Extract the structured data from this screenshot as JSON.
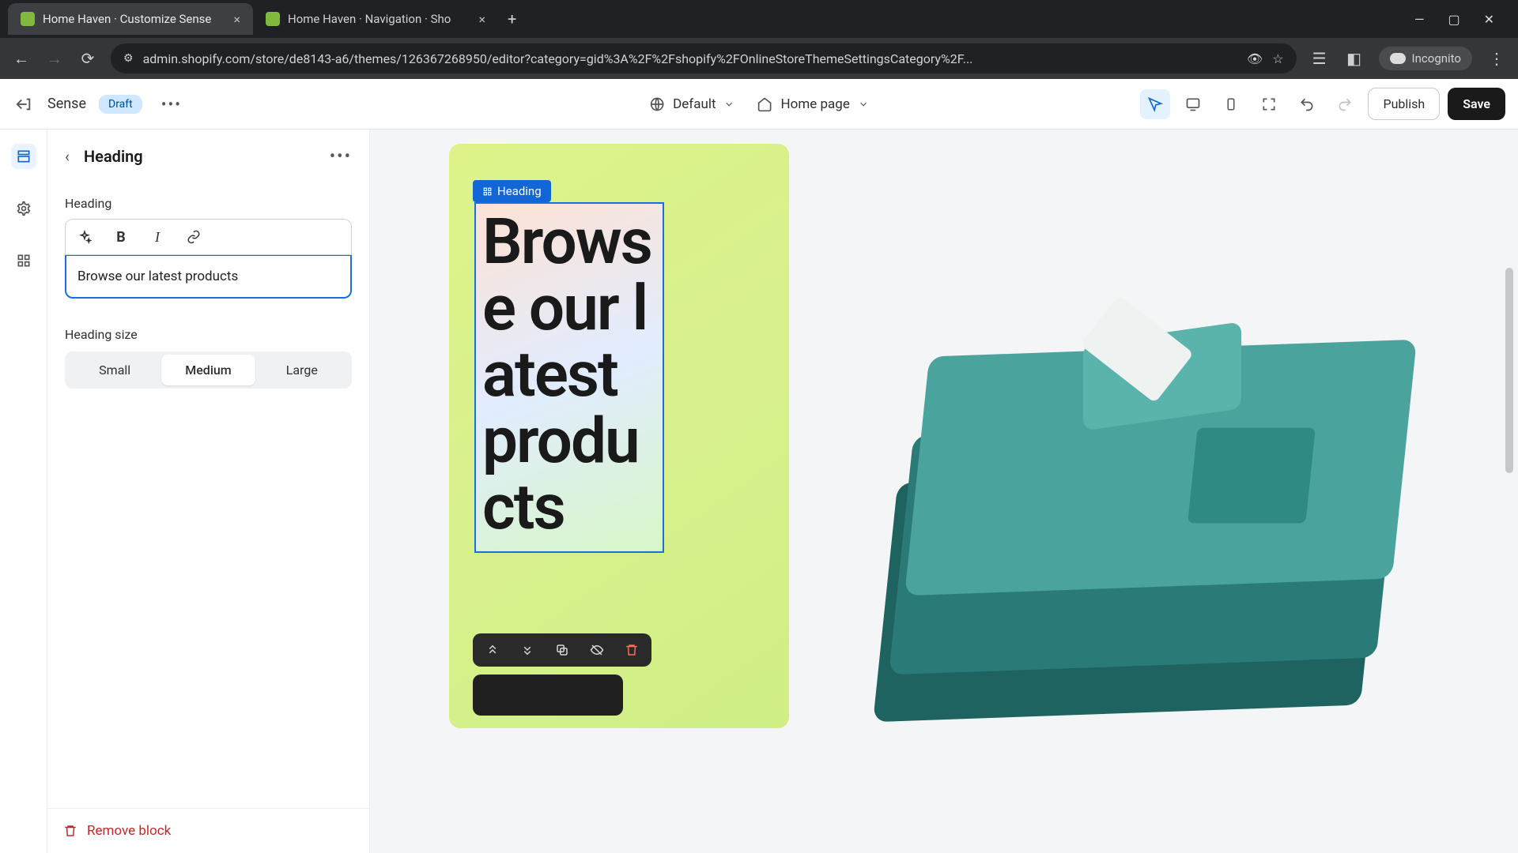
{
  "browser": {
    "tabs": [
      {
        "title": "Home Haven · Customize Sense"
      },
      {
        "title": "Home Haven · Navigation · Sho"
      }
    ],
    "url": "admin.shopify.com/store/de8143-a6/themes/126367268950/editor?category=gid%3A%2F%2Fshopify%2FOnlineStoreThemeSettingsCategory%2F...",
    "incognito_label": "Incognito"
  },
  "topbar": {
    "theme_name": "Sense",
    "badge": "Draft",
    "selector_left": "Default",
    "selector_right": "Home page",
    "publish": "Publish",
    "save": "Save"
  },
  "panel": {
    "title": "Heading",
    "field_label": "Heading",
    "heading_value": "Browse our latest products",
    "size_label": "Heading size",
    "sizes": {
      "small": "Small",
      "medium": "Medium",
      "large": "Large"
    },
    "active_size": "medium",
    "remove_label": "Remove block"
  },
  "preview": {
    "tag_label": "Heading",
    "heading_rendered": "Browse our latest products"
  }
}
